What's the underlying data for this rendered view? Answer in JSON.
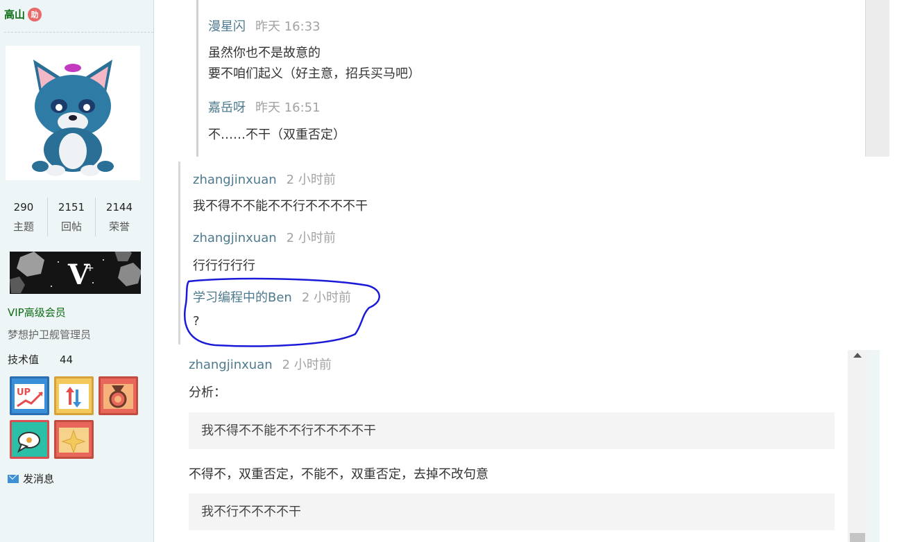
{
  "sidebar": {
    "username": "高山",
    "badge": "助",
    "stats": [
      {
        "value": "290",
        "label": "主题"
      },
      {
        "value": "2151",
        "label": "回帖"
      },
      {
        "value": "2144",
        "label": "荣誉"
      }
    ],
    "vip_banner_text": "V",
    "vip_title": "VIP高级会员",
    "vip_subtitle": "梦想护卫舰管理员",
    "tech_label": "技术值",
    "tech_value": "44",
    "medal_up_text": "UP",
    "message_link": "发消息"
  },
  "quoted_comments": [
    {
      "name": "漫星闪",
      "time": "昨天 16:33",
      "lines": [
        "虽然你也不是故意的",
        "要不咱们起义（好主意，招兵买马吧）"
      ]
    },
    {
      "name": "嘉岳呀",
      "time": "昨天 16:51",
      "lines": [
        "不……不干（双重否定）"
      ]
    }
  ],
  "comments": [
    {
      "name": "zhangjinxuan",
      "time": "2 小时前",
      "text": "我不得不不能不不行不不不不干"
    },
    {
      "name": "zhangjinxuan",
      "time": "2 小时前",
      "text": "行行行行行"
    },
    {
      "name": "学习编程中的Ben",
      "time": "2 小时前",
      "text": "?"
    }
  ],
  "analysis": {
    "name": "zhangjinxuan",
    "time": "2 小时前",
    "heading": "分析：",
    "code1": "我不得不不能不不行不不不不干",
    "explain": "不得不，双重否定，不能不，双重否定，去掉不改句意",
    "code2": "我不行不不不不干"
  },
  "colors": {
    "accent_green": "#0a6b12",
    "name_blue": "#4e7a8e",
    "annotation_blue": "#1a1ad8"
  }
}
